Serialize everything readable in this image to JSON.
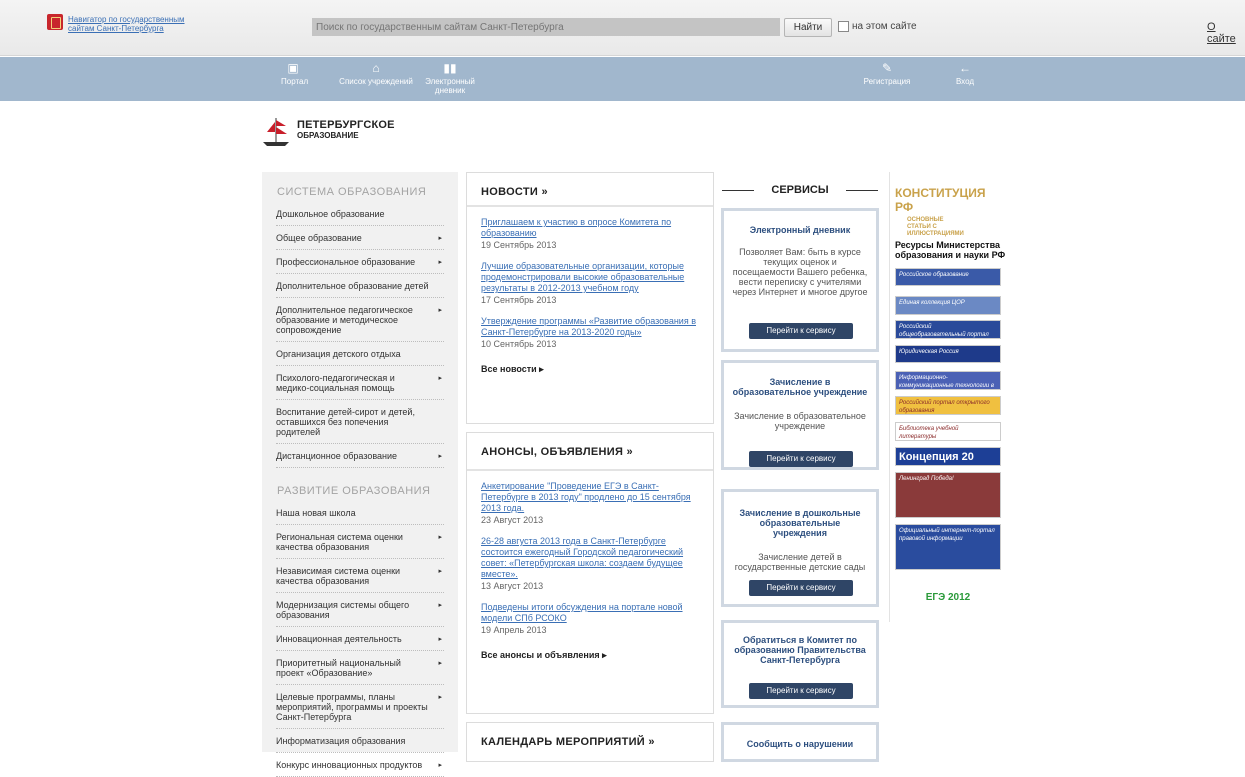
{
  "topbar": {
    "navigator_title": "Навигатор по государственным сайтам Санкт-Петербурга",
    "search_placeholder": "Поиск по государственным сайтам Санкт-Петербурга",
    "find_button": "Найти",
    "site_only_label": "на этом сайте",
    "about_link": "О сайте"
  },
  "nav": {
    "portal": "Портал",
    "institutions": "Список учреждений",
    "diary_line1": "Электронный",
    "diary_line2": "дневник",
    "register": "Регистрация",
    "login": "Вход"
  },
  "brand": {
    "line1": "ПЕТЕРБУРГСКОЕ",
    "line2": "ОБРАЗОВАНИЕ"
  },
  "sidebar": {
    "section1_title": "СИСТЕМА ОБРАЗОВАНИЯ",
    "section1_items": [
      {
        "label": "Дошкольное образование",
        "arrow": ""
      },
      {
        "label": "Общее образование",
        "arrow": "▸"
      },
      {
        "label": "Профессиональное образование",
        "arrow": "▸"
      },
      {
        "label": "Дополнительное образование детей",
        "arrow": ""
      },
      {
        "label": "Дополнительное педагогическое образование и методическое сопровождение",
        "arrow": "▸"
      },
      {
        "label": "Организация детского отдыха",
        "arrow": ""
      },
      {
        "label": "Психолого-педагогическая и медико-социальная помощь",
        "arrow": "▸"
      },
      {
        "label": "Воспитание детей-сирот и детей, оставшихся без попечения родителей",
        "arrow": ""
      },
      {
        "label": "Дистанционное образование",
        "arrow": "▸"
      }
    ],
    "section2_title": "РАЗВИТИЕ ОБРАЗОВАНИЯ",
    "section2_items": [
      {
        "label": "Наша новая школа",
        "arrow": ""
      },
      {
        "label": "Региональная система оценки качества образования",
        "arrow": "▸"
      },
      {
        "label": "Независимая система оценки качества образования",
        "arrow": "▸"
      },
      {
        "label": "Модернизация системы общего образования",
        "arrow": "▸"
      },
      {
        "label": "Инновационная деятельность",
        "arrow": "▸"
      },
      {
        "label": "Приоритетный национальный проект «Образование»",
        "arrow": "▸"
      },
      {
        "label": "Целевые программы, планы мероприятий, программы и проекты Санкт-Петербурга",
        "arrow": "▸"
      },
      {
        "label": "Информатизация образования",
        "arrow": ""
      },
      {
        "label": "Конкурс инновационных продуктов",
        "arrow": "▸"
      }
    ]
  },
  "news": {
    "title": "НОВОСТИ »",
    "items": [
      {
        "text": "Приглашаем к участию в опросе Комитета по образованию",
        "date": "19 Сентябрь 2013"
      },
      {
        "text": "Лучшие образовательные организации, которые продемонстрировали высокие образовательные результаты в 2012-2013 учебном году",
        "date": "17 Сентябрь 2013"
      },
      {
        "text": "Утверждение программы «Развитие образования в Санкт-Петербурге на 2013-2020 годы»",
        "date": "10 Сентябрь 2013"
      }
    ],
    "all_link": "Все новости ▸"
  },
  "announcements": {
    "title": "АНОНСЫ, ОБЪЯВЛЕНИЯ »",
    "items": [
      {
        "text": "Анкетирование \"Проведение ЕГЭ в Санкт-Петербурге в 2013 году\" продлено до 15 сентября 2013 года.",
        "date": "23 Август 2013"
      },
      {
        "text": "26-28 августа 2013 года в Санкт-Петербурге состоится ежегодный Городской педагогический совет: «Петербургская школа: создаем будущее вместе».",
        "date": "13 Август 2013"
      },
      {
        "text": "Подведены итоги обсуждения на портале новой модели СПб РСОКО",
        "date": "19 Апрель 2013"
      }
    ],
    "all_link": "Все анонсы и объявления ▸"
  },
  "calendar": {
    "title": "КАЛЕНДАРЬ МЕРОПРИЯТИЙ »"
  },
  "services": {
    "title": "СЕРВИСЫ",
    "button_label": "Перейти к сервису",
    "items": [
      {
        "title": "Электронный дневник",
        "desc": "Позволяет Вам: быть в курсе текущих оценок и посещаемости Вашего ребенка, вести переписку с учителями через Интернет и многое другое"
      },
      {
        "title": "Зачисление в образовательное учреждение",
        "desc": "Зачисление в образовательное учреждение"
      },
      {
        "title": "Зачисление в дошкольные образовательные учреждения",
        "desc": "Зачисление детей в государственные детские сады"
      },
      {
        "title": "Обратиться в Комитет по образованию Правительства Санкт-Петербурга",
        "desc": ""
      },
      {
        "title": "Сообщить о нарушении",
        "desc": ""
      }
    ]
  },
  "right": {
    "constitution_title": "КОНСТИТУЦИЯ РФ",
    "constitution_sub": "ОСНОВНЫЕ СТАТЬИ С ИЛЛЮСТРАЦИЯМИ",
    "resources_title": "Ресурсы Министерства образования и науки РФ",
    "banners": [
      {
        "label": "Российское образование",
        "color": "#3a5aa8"
      },
      {
        "label": "Единая коллекция ЦОР",
        "color": "#6b89c4"
      },
      {
        "label": "Российский общеобразовательный портал",
        "color": "#2a4a9a"
      },
      {
        "label": "Юридическая Россия",
        "color": "#1e3a8a"
      },
      {
        "label": "Информационно-коммуникационные технологии в образовании",
        "color": "#4b61b5"
      },
      {
        "label": "Российский портал открытого образования",
        "color": "#f0c040"
      },
      {
        "label": "Библиотека учебной литературы",
        "color": "#ffffff"
      },
      {
        "label": "Концепция 20",
        "color": "#1d3f96"
      },
      {
        "label": "Ленинград Победа!",
        "color": "#8a3a3a"
      },
      {
        "label": "Официальный интернет-портал правовой информации",
        "color": "#2a4c9e"
      },
      {
        "label": "ЕГЭ 2012",
        "color": "#2a9a3a"
      }
    ]
  }
}
